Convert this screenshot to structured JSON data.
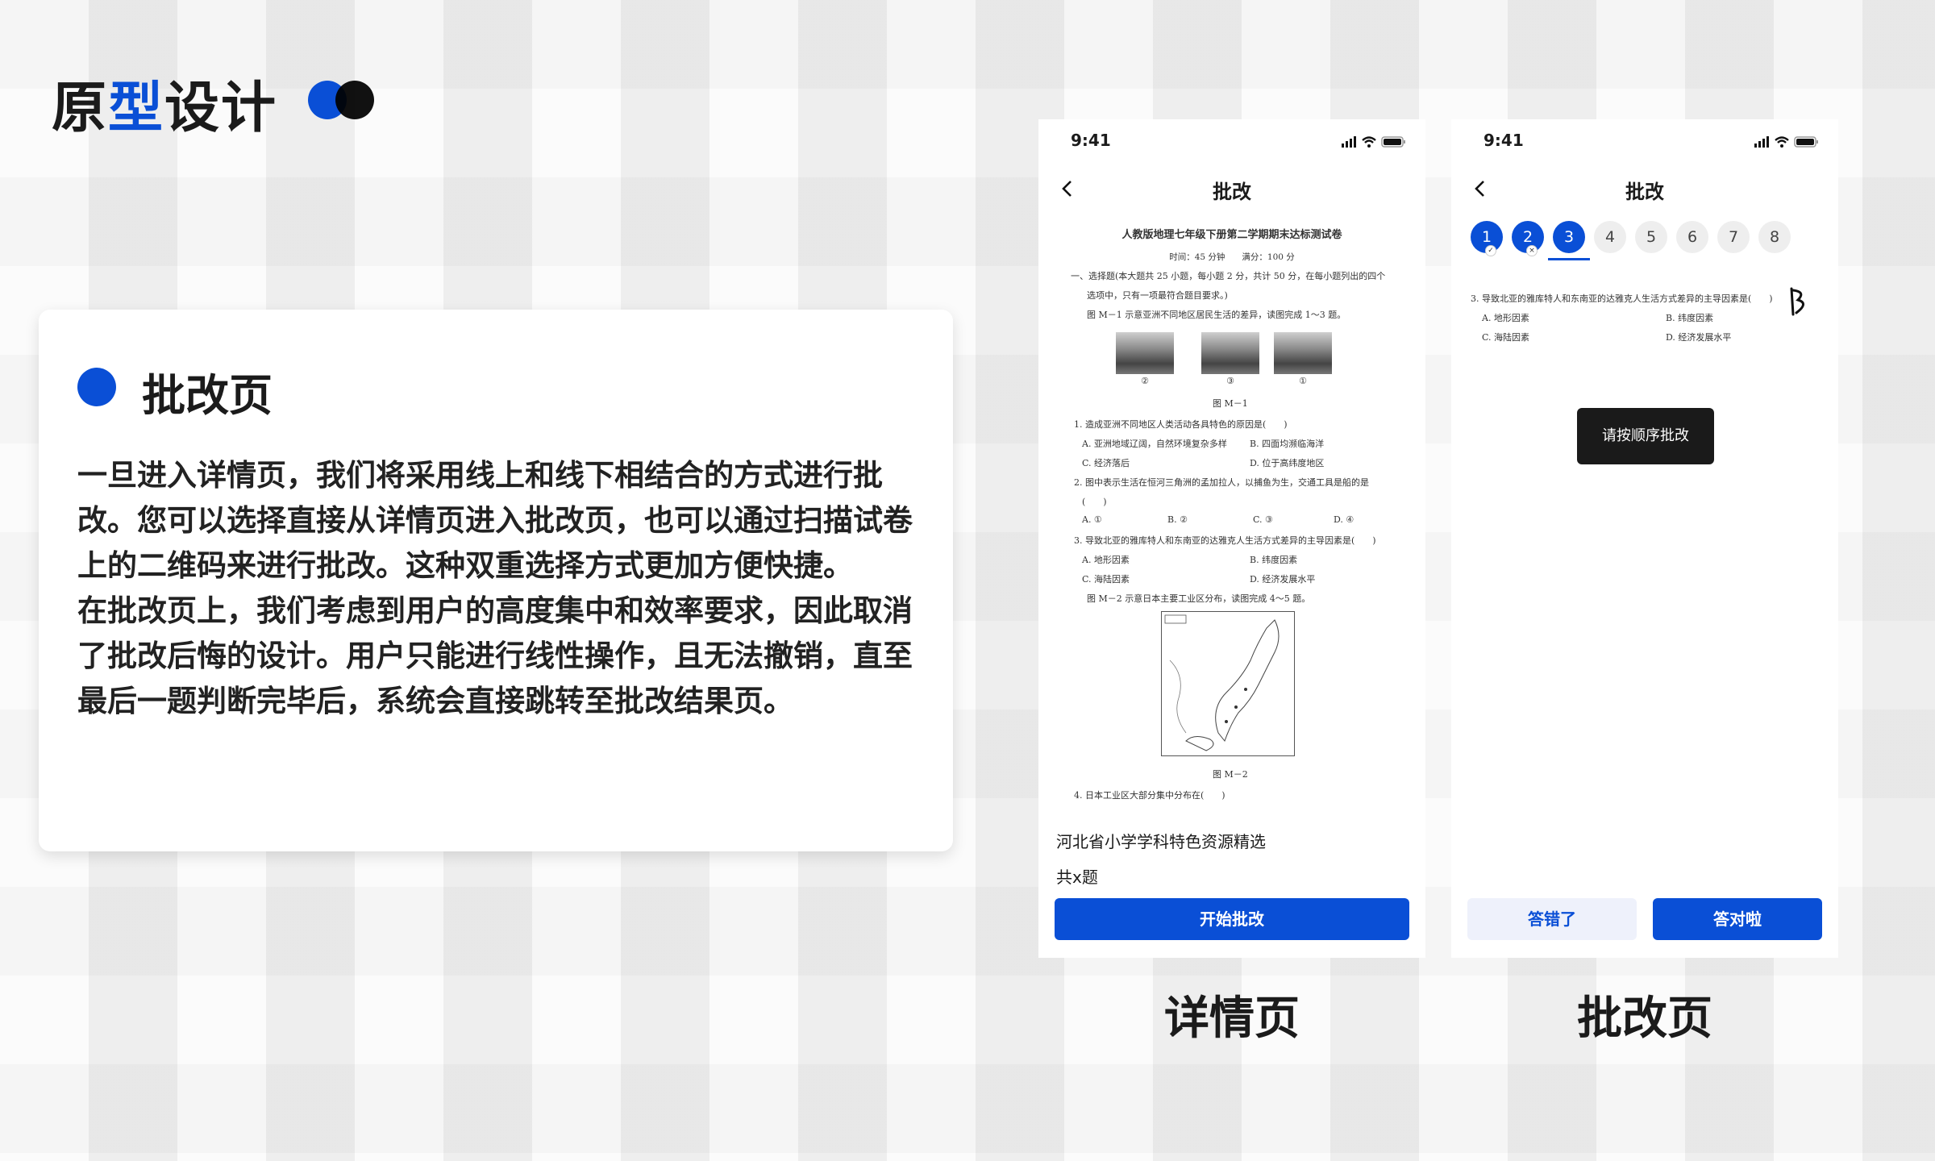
{
  "header": {
    "title_part1": "原",
    "title_accent": "型",
    "title_part2": "设计",
    "accent_color": "#0a4fd6"
  },
  "info_card": {
    "title": "批改页",
    "paragraphs": [
      "一旦进入详情页，我们将采用线上和线下相结合的方式进行批改。您可以选择直接从详情页进入批改页，也可以通过扫描试卷上的二维码来进行批改。这种双重选择方式更加方便快捷。",
      "在批改页上，我们考虑到用户的高度集中和效率要求，因此取消了批改后悔的设计。用户只能进行线性操作，且无法撤销，直至最后一题判断完毕后，系统会直接跳转至批改结果页。"
    ]
  },
  "detail_phone": {
    "time": "9:41",
    "nav_title": "批改",
    "paper": {
      "title": "人教版地理七年级下册第二学期期末达标测试卷",
      "meta": "时间：45 分钟　　满分：100 分",
      "section1": "一、选择题(本大题共 25 小题，每小题 2 分，共计 50 分，在每小题列出的四个",
      "section1b": "选项中，只有一项最符合题目要求。)",
      "fig_intro": "图 M－1 示意亚洲不同地区居民生活的差异，读图完成 1～3 题。",
      "photo_labels": [
        "②",
        "③",
        "①"
      ],
      "fig1_caption": "图 M－1",
      "q1": "1. 造成亚洲不同地区人类活动各具特色的原因是(　　)",
      "q1a": "A. 亚洲地域辽阔，自然环境复杂多样",
      "q1b": "B. 四面均濒临海洋",
      "q1c": "C. 经济落后",
      "q1d": "D. 位于高纬度地区",
      "q2": "2. 图中表示生活在恒河三角洲的孟加拉人，以捕鱼为生，交通工具是船的是",
      "q2paren": "(　　)",
      "q2a": "A. ①",
      "q2b": "B. ②",
      "q2c": "C. ③",
      "q2d": "D. ④",
      "q3": "3. 导致北亚的雅库特人和东南亚的达雅克人生活方式差异的主导因素是(　　)",
      "q3a": "A. 地形因素",
      "q3b": "B. 纬度因素",
      "q3c": "C. 海陆因素",
      "q3d": "D. 经济发展水平",
      "fig2_intro": "图 M－2 示意日本主要工业区分布，读图完成 4～5 题。",
      "fig2_caption": "图 M－2",
      "q4": "4. 日本工业区大部分集中分布在(　　)"
    },
    "source": "河北省小学学科特色资源精选",
    "count": "共x题",
    "start_button": "开始批改",
    "caption": "详情页"
  },
  "grading_phone": {
    "time": "9:41",
    "nav_title": "批改",
    "question_numbers": [
      "1",
      "2",
      "3",
      "4",
      "5",
      "6",
      "7",
      "8"
    ],
    "question_text": "3. 导致北亚的雅库特人和东南亚的达雅克人生活方式差异的主导因素是(　　)",
    "option_a": "A. 地形因素",
    "option_b": "B. 纬度因素",
    "option_c": "C. 海陆因素",
    "option_d": "D. 经济发展水平",
    "tooltip": "请按顺序批改",
    "wrong_button": "答错了",
    "right_button": "答对啦",
    "caption": "批改页"
  }
}
